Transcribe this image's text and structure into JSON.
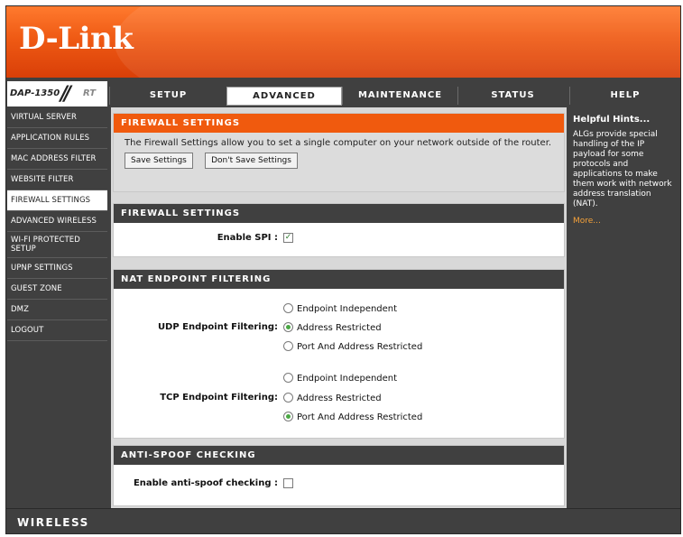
{
  "brand": {
    "logo": "D-Link",
    "model": "DAP-1350",
    "model_suffix": "RT",
    "footer": "WIRELESS"
  },
  "nav": {
    "tabs": [
      {
        "label": "SETUP",
        "active": false
      },
      {
        "label": "ADVANCED",
        "active": true
      },
      {
        "label": "MAINTENANCE",
        "active": false
      },
      {
        "label": "STATUS",
        "active": false
      },
      {
        "label": "HELP",
        "active": false
      }
    ]
  },
  "sidebar": {
    "items": [
      {
        "label": "VIRTUAL SERVER"
      },
      {
        "label": "APPLICATION RULES"
      },
      {
        "label": "MAC ADDRESS FILTER"
      },
      {
        "label": "WEBSITE FILTER"
      },
      {
        "label": "FIREWALL SETTINGS",
        "active": true
      },
      {
        "label": "ADVANCED WIRELESS"
      },
      {
        "label": "WI-FI PROTECTED SETUP"
      },
      {
        "label": "UPNP SETTINGS"
      },
      {
        "label": "GUEST ZONE"
      },
      {
        "label": "DMZ"
      },
      {
        "label": "LOGOUT"
      }
    ]
  },
  "intro": {
    "title": "FIREWALL SETTINGS",
    "text": "The Firewall Settings allow you to set a single computer on your network outside of the router.",
    "save_label": "Save Settings",
    "dont_save_label": "Don't Save Settings"
  },
  "firewall": {
    "title": "FIREWALL SETTINGS",
    "spi_label": "Enable SPI :",
    "spi_checked": true
  },
  "nat": {
    "title": "NAT ENDPOINT FILTERING",
    "udp_label": "UDP Endpoint Filtering:",
    "tcp_label": "TCP Endpoint Filtering:",
    "options": [
      "Endpoint Independent",
      "Address Restricted",
      "Port And Address Restricted"
    ],
    "udp_selected": "Address Restricted",
    "tcp_selected": "Port And Address Restricted"
  },
  "antispoof": {
    "title": "ANTI-SPOOF CHECKING",
    "label": "Enable anti-spoof checking :",
    "checked": false
  },
  "help": {
    "title": "Helpful Hints...",
    "text": "ALGs provide special handling of the IP payload for some protocols and applications to make them work with network address translation (NAT).",
    "more": "More..."
  },
  "colors": {
    "accent": "#f05a0e",
    "dark": "#404040",
    "more_link": "#f5a23a",
    "radio_on": "#4aa844"
  }
}
